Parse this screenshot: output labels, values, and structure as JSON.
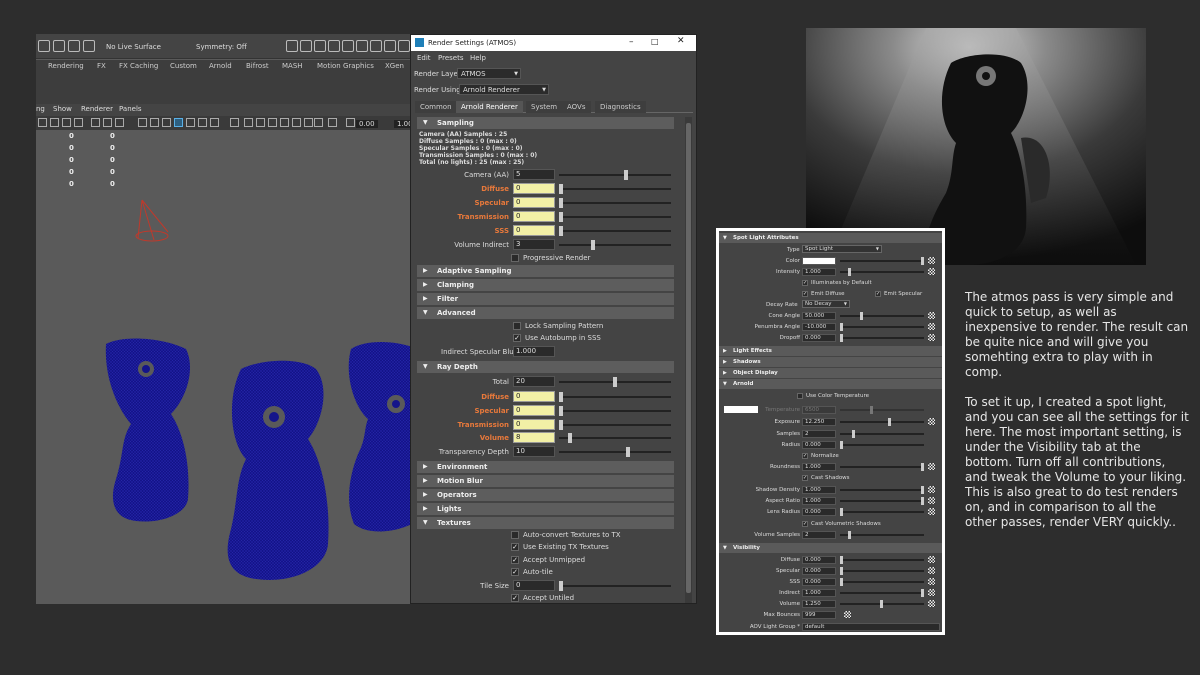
{
  "viewport": {
    "top_toolbar": {
      "live_surface": "No Live Surface",
      "symmetry": "Symmetry: Off"
    },
    "shelf_tabs": [
      "Rendering",
      "FX",
      "FX Caching",
      "Custom",
      "Arnold",
      "Bifrost",
      "MASH",
      "Motion Graphics",
      "XGen"
    ],
    "panel_menu": [
      "ng",
      "Show",
      "Renderer",
      "Panels"
    ],
    "toolbar_values": {
      "exposure": "0.00",
      "gamma": "1.00"
    },
    "hud_left": [
      "0",
      "0",
      "0",
      "0",
      "0"
    ],
    "hud_right": [
      "0",
      "0",
      "0",
      "0",
      "0"
    ]
  },
  "render_settings": {
    "window_title": "Render Settings (ATMOS)",
    "menu": [
      "Edit",
      "Presets",
      "Help"
    ],
    "render_layer_label": "Render Layer",
    "render_layer_value": "ATMOS",
    "render_using_label": "Render Using",
    "render_using_value": "Arnold Renderer",
    "tabs": [
      "Common",
      "Arnold Renderer",
      "System",
      "AOVs",
      "Diagnostics"
    ],
    "sampling": {
      "title": "Sampling",
      "info": [
        "Camera (AA) Samples : 25",
        "Diffuse Samples : 0 (max : 0)",
        "Specular Samples : 0 (max : 0)",
        "Transmission Samples : 0 (max : 0)",
        "Total (no lights) : 25 (max : 25)"
      ],
      "camera_aa_label": "Camera (AA)",
      "camera_aa": "5",
      "camera_aa_level": 0.6,
      "diffuse_label": "Diffuse",
      "diffuse": "0",
      "specular_label": "Specular",
      "specular": "0",
      "transmission_label": "Transmission",
      "transmission": "0",
      "sss_label": "SSS",
      "sss": "0",
      "volume_indirect_label": "Volume Indirect",
      "volume_indirect": "3",
      "volume_indirect_level": 0.3,
      "progressive_render": "Progressive Render"
    },
    "collapsed_1": [
      "Adaptive Sampling",
      "Clamping",
      "Filter"
    ],
    "advanced": {
      "title": "Advanced",
      "lock_sampling": "Lock Sampling Pattern",
      "use_autobump": "Use Autobump in SSS",
      "indirect_specular_blur_label": "Indirect Specular Blur",
      "indirect_specular_blur": "1.000"
    },
    "ray_depth": {
      "title": "Ray Depth",
      "total_label": "Total",
      "total": "20",
      "total_level": 0.5,
      "diffuse_label": "Diffuse",
      "diffuse": "0",
      "specular_label": "Specular",
      "specular": "0",
      "transmission_label": "Transmission",
      "transmission": "0",
      "volume_label": "Volume",
      "volume": "8",
      "volume_level": 0.08,
      "transparency_depth_label": "Transparency Depth",
      "transparency_depth": "10",
      "transparency_level": 0.62
    },
    "collapsed_2": [
      "Environment",
      "Motion Blur",
      "Operators",
      "Lights"
    ],
    "textures": {
      "title": "Textures",
      "auto_convert": "Auto-convert Textures to TX",
      "use_existing": "Use Existing TX Textures",
      "accept_unmipped": "Accept Unmipped",
      "auto_tile": "Auto-tile",
      "tile_size_label": "Tile Size",
      "tile_size": "0",
      "accept_untiled": "Accept Untiled"
    }
  },
  "spot_light": {
    "header": "Spot Light Attributes",
    "type_label": "Type",
    "type_value": "Spot Light",
    "color_label": "Color",
    "intensity_label": "Intensity",
    "intensity": "1.000",
    "illuminates_default": "Illuminates by Default",
    "emit_diffuse": "Emit Diffuse",
    "emit_specular": "Emit Specular",
    "decay_rate_label": "Decay Rate",
    "decay_rate": "No Decay",
    "cone_angle_label": "Cone Angle",
    "cone_angle": "50.000",
    "penumbra_angle_label": "Penumbra Angle",
    "penumbra_angle": "-10.000",
    "dropoff_label": "Dropoff",
    "dropoff": "0.000",
    "collapsed": [
      "Light Effects",
      "Shadows",
      "Object Display"
    ],
    "arnold_header": "Arnold",
    "use_color_temperature": "Use Color Temperature",
    "temperature_label": "Temperature",
    "temperature": "6500",
    "exposure_label": "Exposure",
    "exposure": "12.250",
    "samples_label": "Samples",
    "samples": "2",
    "radius_label": "Radius",
    "radius": "0.000",
    "normalize": "Normalize",
    "roundness_label": "Roundness",
    "roundness": "1.000",
    "cast_shadows": "Cast Shadows",
    "shadow_density_label": "Shadow Density",
    "shadow_density": "1.000",
    "aspect_ratio_label": "Aspect Ratio",
    "aspect_ratio": "1.000",
    "lens_radius_label": "Lens Radius",
    "lens_radius": "0.000",
    "cast_volumetric_shadows": "Cast Volumetric Shadows",
    "volume_samples_label": "Volume Samples",
    "volume_samples": "2",
    "visibility_header": "Visibility",
    "vis_diffuse_label": "Diffuse",
    "vis_diffuse": "0.000",
    "vis_specular_label": "Specular",
    "vis_specular": "0.000",
    "vis_sss_label": "SSS",
    "vis_sss": "0.000",
    "vis_indirect_label": "Indirect",
    "vis_indirect": "1.000",
    "vis_volume_label": "Volume",
    "vis_volume": "1.250",
    "max_bounces_label": "Max Bounces",
    "max_bounces": "999",
    "aov_light_group_label": "AOV Light Group *",
    "aov_light_group": "default"
  },
  "description": {
    "para1": "The atmos pass is very simple and quick to setup, as well as inexpensive to render. The result can be quite nice and will give you somehting extra to play with in comp.",
    "para2": "To set it up, I created a spot light, and you can see all the settings for it here. The most important setting, is under the Visibility tab at the bottom. Turn off all contributions, and tweak the Volume to your liking. This is also great to do test renders on, and in comparison to all the other passes, render VERY quickly.."
  },
  "colors": {
    "accent_orange": "#e8793b",
    "mesh_blue": "#14148a",
    "cone_red": "#c0392b"
  }
}
